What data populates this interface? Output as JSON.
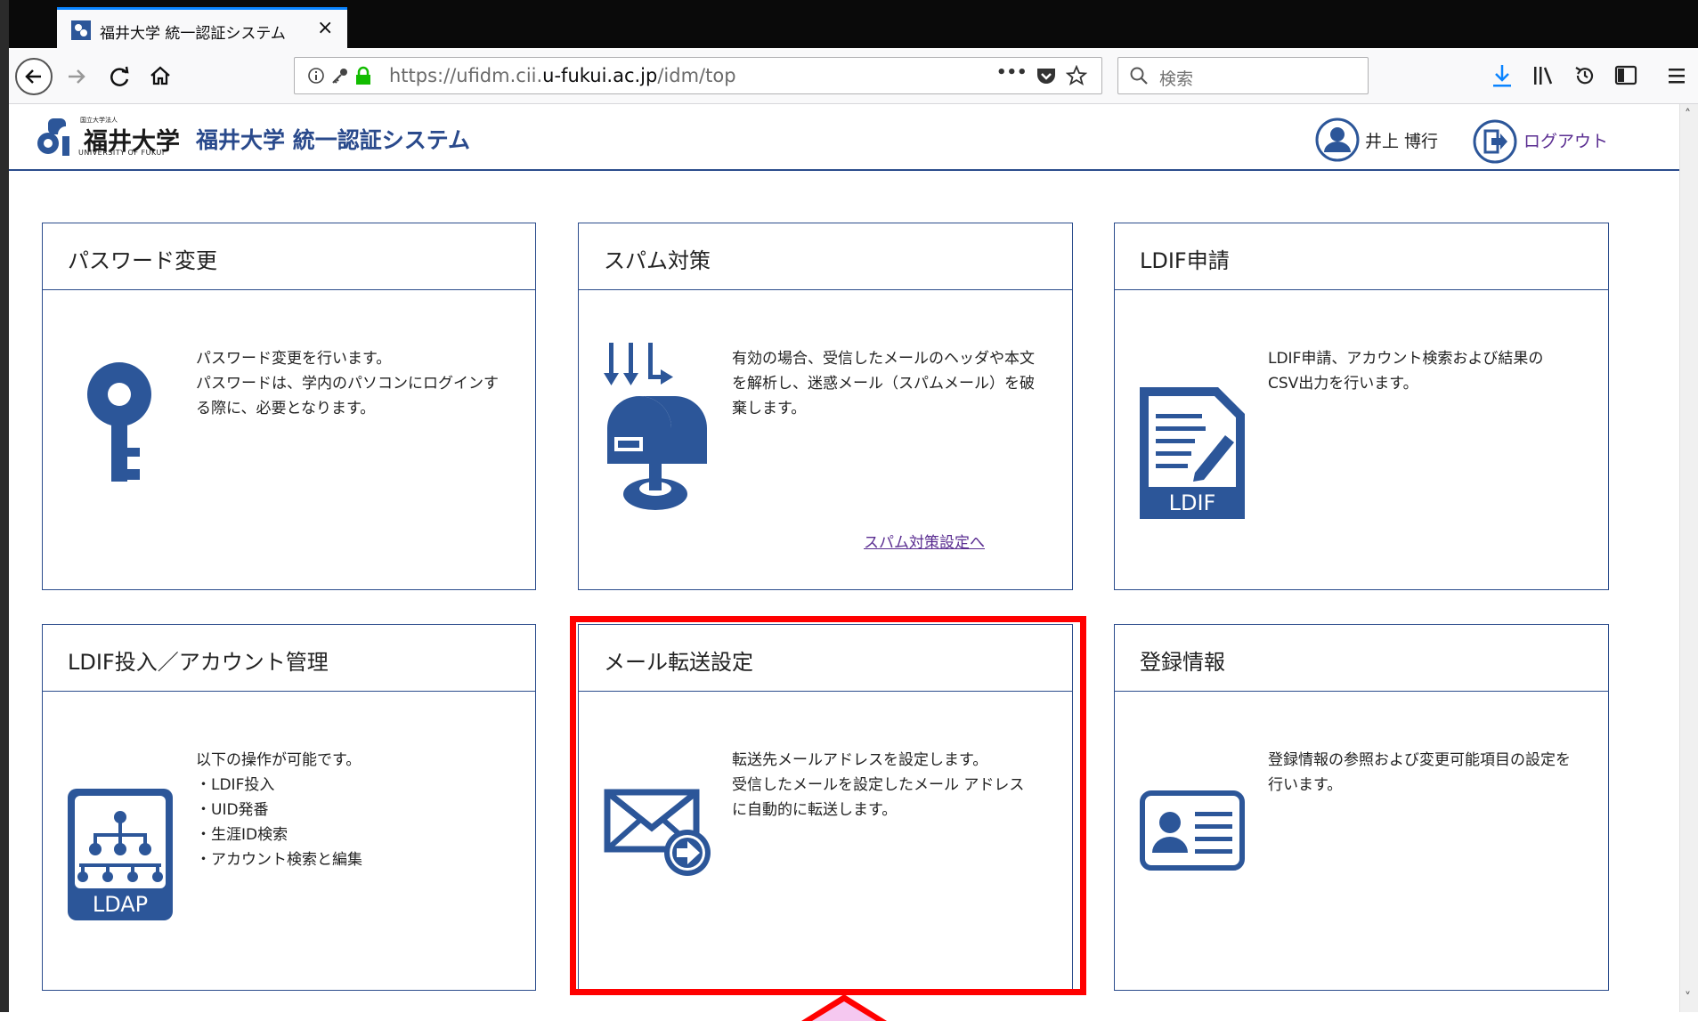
{
  "browser": {
    "tab_title": "福井大学 統一認証システム",
    "tab_close": "×",
    "url_prefix": "https://ufidm.cii.",
    "url_domain": "u-fukui.ac.jp",
    "url_path": "/idm/top",
    "search_placeholder": "検索",
    "more_icon": "•••"
  },
  "header": {
    "brand_top": "国立大学法人",
    "brand_name": "福井大学",
    "brand_sub": "UNIVERSITY OF FUKUI",
    "system_title": "福井大学 統一認証システム",
    "user_name": "井上 博行",
    "logout_label": "ログアウト"
  },
  "cards": [
    {
      "title": "パスワード変更",
      "desc": "パスワード変更を行います。\nパスワードは、学内のパソコンにログインす\nる際に、必要となります。",
      "icon": "key-icon"
    },
    {
      "title": "スパム対策",
      "desc": "有効の場合、受信したメールのヘッダや本文\nを解析し、迷惑メール（スパムメール）を破\n棄します。",
      "link": "スパム対策設定へ",
      "icon": "mailbox-icon"
    },
    {
      "title": "LDIF申請",
      "desc": "LDIF申請、アカウント検索および結果の\nCSV出力を行います。",
      "icon": "ldif-document-icon",
      "icon_label": "LDIF"
    },
    {
      "title": "LDIF投入／アカウント管理",
      "desc": "以下の操作が可能です。\n・LDIF投入\n・UID発番\n・生涯ID検索\n・アカウント検索と編集",
      "icon": "ldap-icon",
      "icon_label": "LDAP"
    },
    {
      "title": "メール転送設定",
      "desc": "転送先メールアドレスを設定します。\n受信したメールを設定したメール アドレス\nに自動的に転送します。",
      "icon": "mail-forward-icon"
    },
    {
      "title": "登録情報",
      "desc": "登録情報の参照および変更可能項目の設定を\n行います。",
      "icon": "id-card-icon"
    }
  ],
  "colors": {
    "accent": "#2b4c8c",
    "highlight": "#ff0000",
    "icon_blue": "#2c5699"
  }
}
